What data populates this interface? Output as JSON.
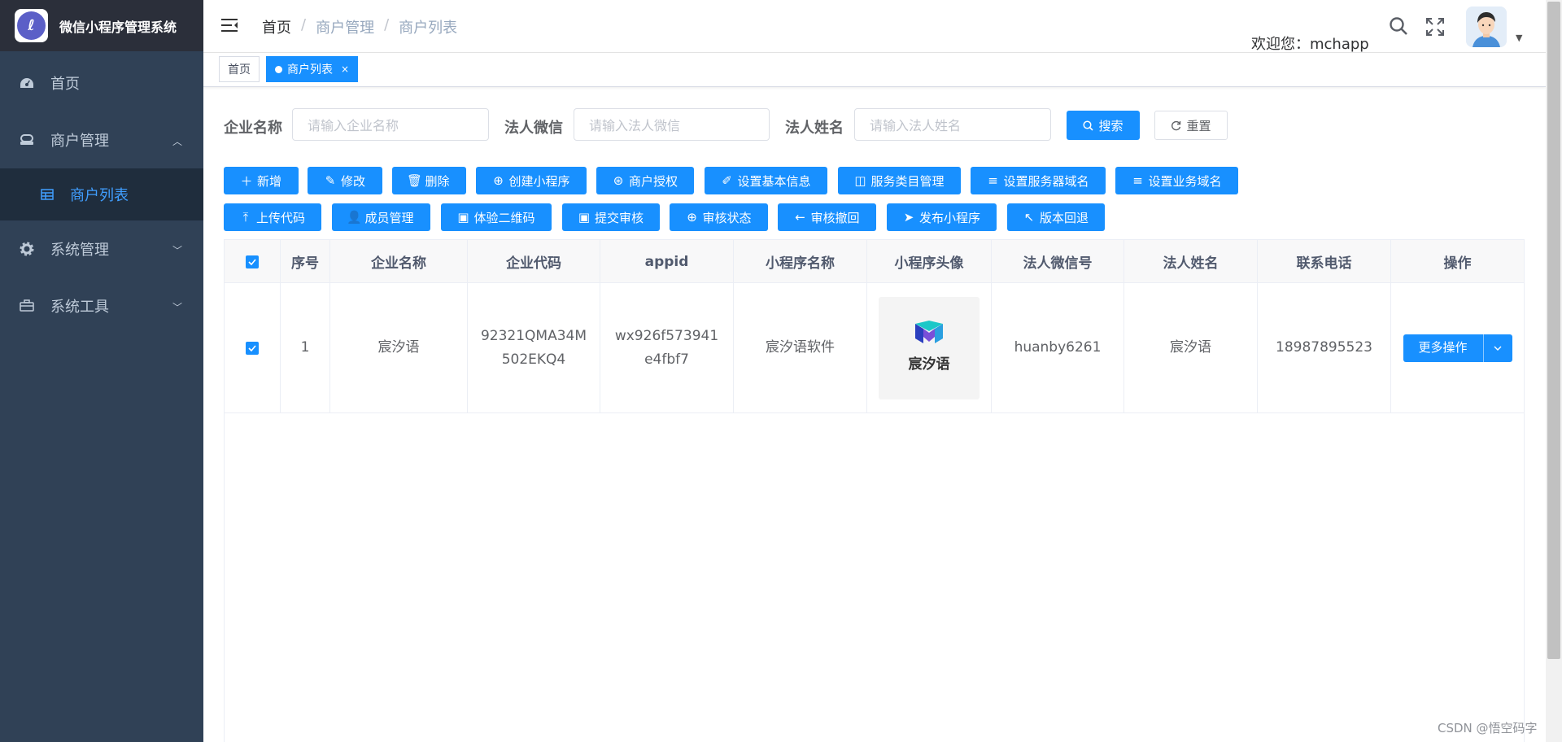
{
  "app": {
    "title": "微信小程序管理系统",
    "logo_glyph": "ℓ"
  },
  "sidebar": {
    "items": [
      {
        "label": "首页",
        "icon": "dashboard-icon"
      },
      {
        "label": "商户管理",
        "icon": "merchant-icon",
        "expanded": true,
        "children": [
          {
            "label": "商户列表",
            "icon": "table-icon",
            "active": true
          }
        ]
      },
      {
        "label": "系统管理",
        "icon": "gear-icon"
      },
      {
        "label": "系统工具",
        "icon": "toolbox-icon"
      }
    ]
  },
  "header": {
    "breadcrumb": [
      "首页",
      "商户管理",
      "商户列表"
    ],
    "separator": "/",
    "welcome": "欢迎您：mchapp"
  },
  "tags": [
    {
      "label": "首页",
      "active": false
    },
    {
      "label": "商户列表",
      "active": true,
      "close": "×"
    }
  ],
  "search": {
    "fields": [
      {
        "label": "企业名称",
        "placeholder": "请输入企业名称"
      },
      {
        "label": "法人微信",
        "placeholder": "请输入法人微信"
      },
      {
        "label": "法人姓名",
        "placeholder": "请输入法人姓名"
      }
    ],
    "search_label": "搜索",
    "reset_label": "重置"
  },
  "toolbar": {
    "row1": [
      {
        "label": "新增",
        "icon": "plus-icon"
      },
      {
        "label": "修改",
        "icon": "edit-icon"
      },
      {
        "label": "删除",
        "icon": "delete-icon"
      },
      {
        "label": "创建小程序",
        "icon": "plus-circle-icon"
      },
      {
        "label": "商户授权",
        "icon": "authorize-icon"
      },
      {
        "label": "设置基本信息",
        "icon": "edit-outline-icon"
      },
      {
        "label": "服务类目管理",
        "icon": "bag-icon"
      },
      {
        "label": "设置服务器域名",
        "icon": "menu-icon"
      },
      {
        "label": "设置业务域名",
        "icon": "menu-icon"
      }
    ],
    "row2": [
      {
        "label": "上传代码",
        "icon": "upload-icon"
      },
      {
        "label": "成员管理",
        "icon": "user-icon"
      },
      {
        "label": "体验二维码",
        "icon": "picture-icon"
      },
      {
        "label": "提交审核",
        "icon": "picture-icon"
      },
      {
        "label": "审核状态",
        "icon": "plus-circle-icon"
      },
      {
        "label": "审核撤回",
        "icon": "back-icon"
      },
      {
        "label": "发布小程序",
        "icon": "send-icon"
      },
      {
        "label": "版本回退",
        "icon": "top-left-icon"
      }
    ]
  },
  "table": {
    "columns": [
      "序号",
      "企业名称",
      "企业代码",
      "appid",
      "小程序名称",
      "小程序头像",
      "法人微信号",
      "法人姓名",
      "联系电话",
      "操作"
    ],
    "rows": [
      {
        "checked": true,
        "index": "1",
        "company": "宸汐语",
        "code": "92321QMA34M502EKQ4",
        "appid": "wx926f573941e4fbf7",
        "app_name": "宸汐语软件",
        "avatar_text": "宸汐语",
        "wechat": "huanby6261",
        "legal_name": "宸汐语",
        "phone": "18987895523",
        "action": "更多操作"
      }
    ]
  },
  "watermark": "CSDN @悟空码字",
  "colors": {
    "primary": "#1890ff",
    "sidebar": "#304156",
    "sidebar_logo": "#2b2f3a",
    "submenu": "#1f2d3d",
    "active_text": "#409eff"
  }
}
